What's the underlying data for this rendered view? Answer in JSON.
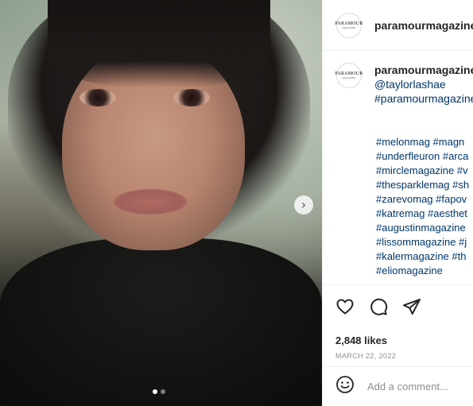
{
  "post": {
    "username": "paramourmagazine",
    "avatar_logo": "PARAMOUR",
    "avatar_logo_sub": "MAGAZINE",
    "caption": {
      "username": "paramourmagazine",
      "mention": "@taylorlashae",
      "tag": "#paramourmagazine"
    },
    "hashtags": [
      "#melonmag #magn",
      "#underfleuron #arca",
      "#mirclemagazine #v",
      "#thesparklemag #sh",
      "#zarevomag #fapov",
      "#katremag #aesthet",
      "#augustinmagazine",
      "#lissommagazine #j",
      "#kalermagazine #th",
      "#eliomagazine"
    ],
    "likes": "2,848 likes",
    "date": "MARCH 22, 2022"
  },
  "media": {
    "next_icon": "chevron-right-icon",
    "next_glyph": "›",
    "carousel_dots": 2,
    "active_dot": 1
  },
  "actions": {
    "icons": [
      "heart-icon",
      "comment-icon",
      "share-icon"
    ]
  },
  "comment": {
    "placeholder": "Add a comment...",
    "emoji_icon": "emoji-icon"
  }
}
